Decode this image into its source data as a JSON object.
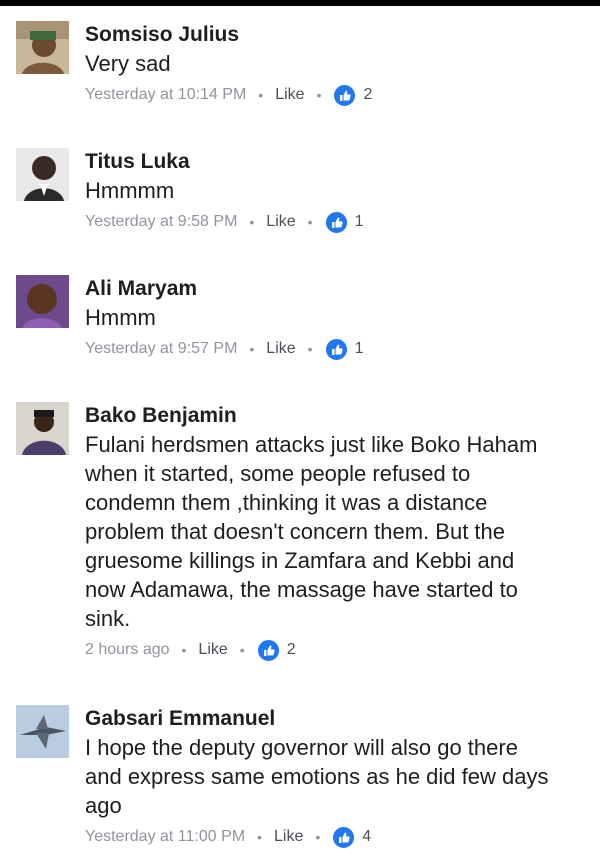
{
  "comments": [
    {
      "name": "Somsiso Julius",
      "text": "Very sad",
      "time": "Yesterday at 10:14 PM",
      "like_label": "Like",
      "like_count": "2",
      "avatar_icon": "profile-photo"
    },
    {
      "name": "Titus Luka",
      "text": "Hmmmm",
      "time": "Yesterday at 9:58 PM",
      "like_label": "Like",
      "like_count": "1",
      "avatar_icon": "profile-photo"
    },
    {
      "name": "Ali Maryam",
      "text": "Hmmm",
      "time": "Yesterday at 9:57 PM",
      "like_label": "Like",
      "like_count": "1",
      "avatar_icon": "profile-photo"
    },
    {
      "name": "Bako Benjamin",
      "text": "Fulani herdsmen attacks just like Boko Haham\nwhen it started, some people refused to\ncondemn them ,thinking it was a distance\nproblem that doesn't concern them. But the\ngruesome killings in Zamfara and Kebbi and\nnow Adamawa, the massage have started to\nsink.",
      "time": "2 hours ago",
      "like_label": "Like",
      "like_count": "2",
      "avatar_icon": "profile-photo"
    },
    {
      "name": "Gabsari Emmanuel",
      "text": "I hope the deputy governor will also go there\nand express same emotions as he did few days\nago",
      "time": "Yesterday at 11:00 PM",
      "like_label": "Like",
      "like_count": "4",
      "avatar_icon": "profile-photo"
    }
  ],
  "colors": {
    "like_blue": "#1f77f2",
    "meta_gray": "#90949c",
    "name_text": "#1c1e21"
  }
}
